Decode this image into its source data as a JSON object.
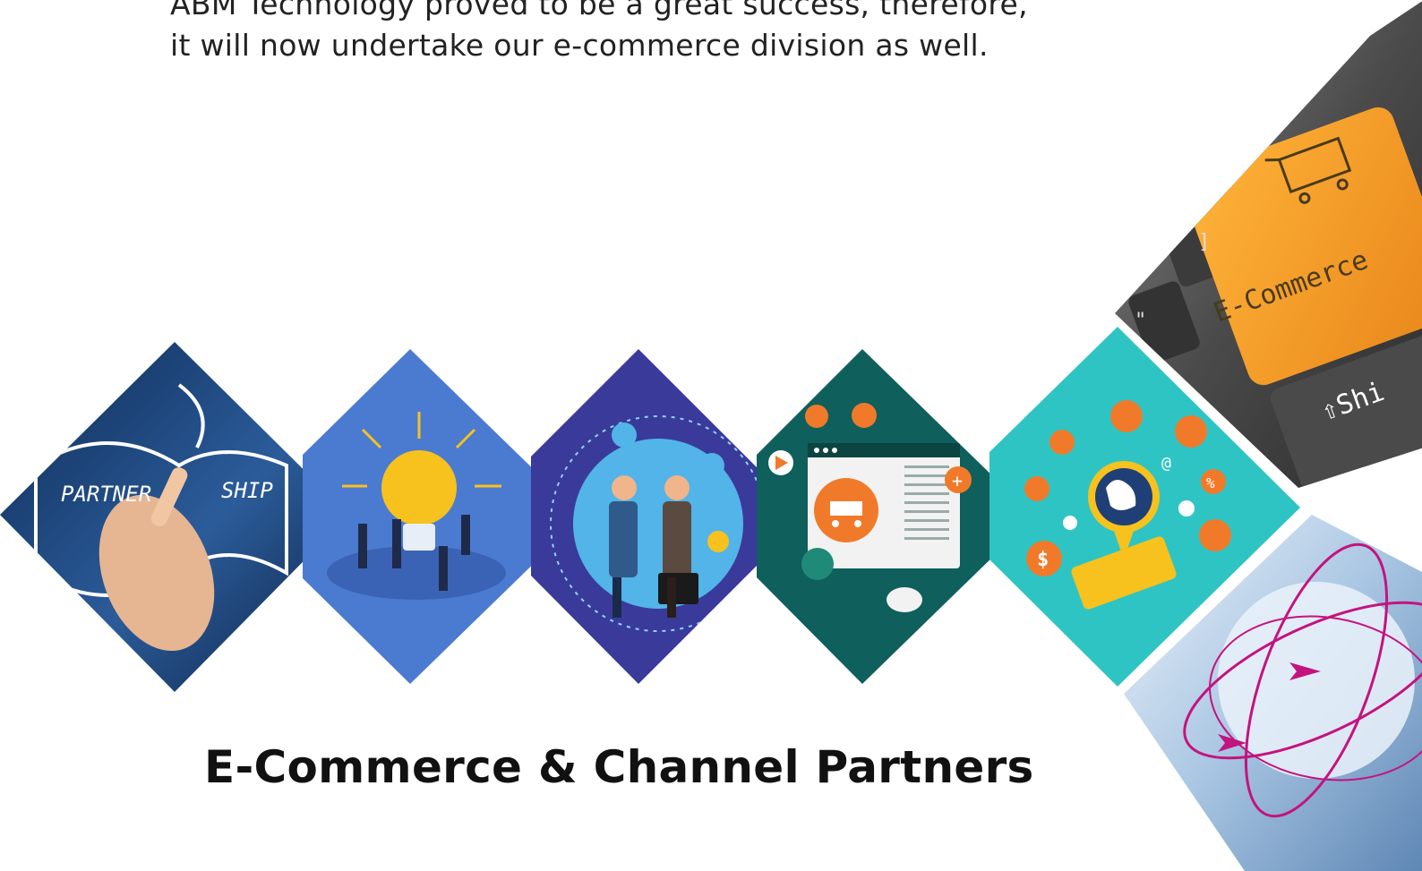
{
  "intro": {
    "line1": "ABM Technology proved to be a great success, therefore,",
    "line2": "it will now undertake our e-commerce division as well."
  },
  "heading": "E-Commerce & Channel Partners",
  "tiles": {
    "partnership": {
      "word1": "PARTNER",
      "word2": "SHIP"
    },
    "keyboard": {
      "key_label": "E-Commerce",
      "shift_label": "⇧Shi",
      "bracket": "]",
      "quote": "\""
    }
  },
  "icon_glyphs": {
    "dollar": "$",
    "percent": "%",
    "at": "@",
    "plus": "+"
  },
  "colors": {
    "tile_partnership": "#1a3a66",
    "tile_idea": "#4b7bd0",
    "tile_handshake": "#3a3a9a",
    "tile_marketing": "#0f5f5c",
    "tile_global": "#2fc4c4",
    "tile_keyboard": "#5a5a5a",
    "tile_travel": "#c8dcef",
    "accent_orange": "#f07a2a",
    "accent_yellow": "#f7c21e"
  }
}
